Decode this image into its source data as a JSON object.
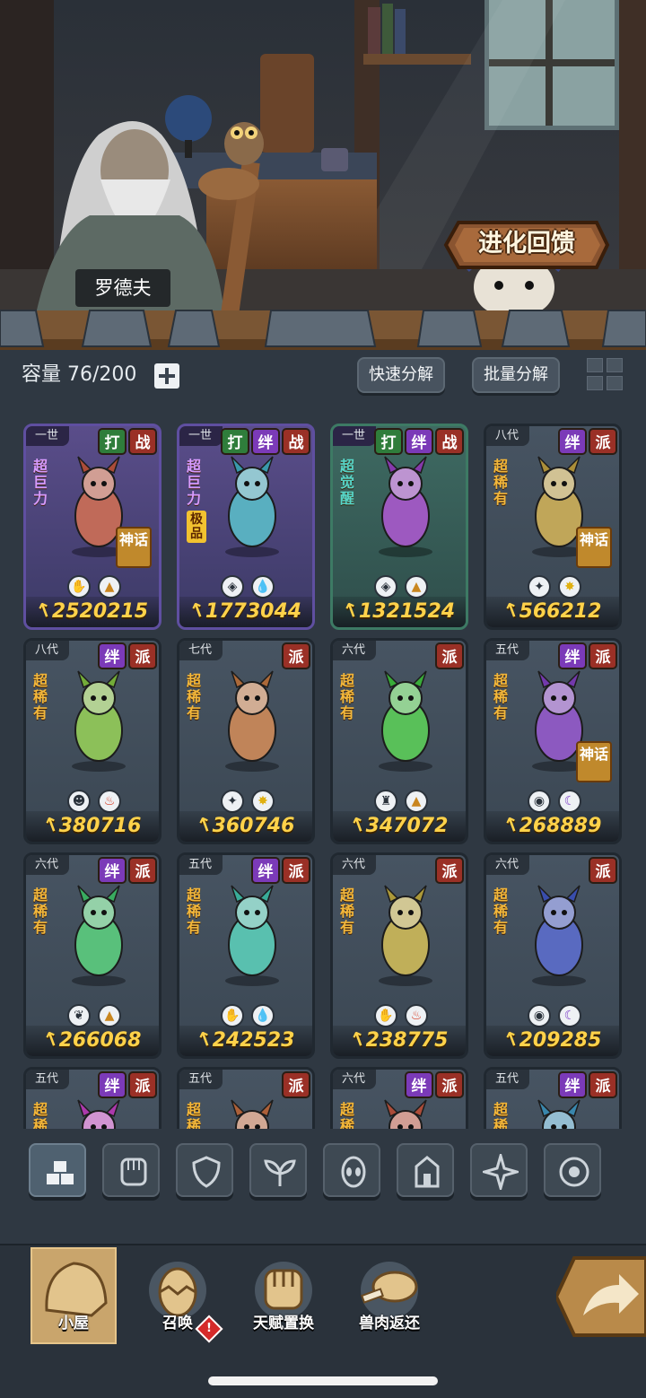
{
  "npc": {
    "name": "罗德夫"
  },
  "evolve_button": {
    "label": "进化回馈"
  },
  "inventory": {
    "capacity_label": "容量 76/200",
    "quick_decompose": "快速分解",
    "batch_decompose": "批量分解"
  },
  "cards": [
    {
      "gen": "一世",
      "badges": [
        "打",
        "战"
      ],
      "rarity": "超巨力",
      "extra": "",
      "myth": "神话",
      "icons": [
        "paw-icon",
        "rock-icon"
      ],
      "power": "2520215",
      "style": "purple"
    },
    {
      "gen": "一世",
      "badges": [
        "打",
        "绊",
        "战"
      ],
      "rarity": "超巨力",
      "extra": "极品",
      "myth": "",
      "icons": [
        "shield-icon",
        "water-icon"
      ],
      "power": "1773044",
      "style": "purple"
    },
    {
      "gen": "一世",
      "badges": [
        "打",
        "绊",
        "战"
      ],
      "rarity": "超觉醒",
      "extra": "",
      "myth": "",
      "icons": [
        "shield-icon",
        "rock-icon"
      ],
      "power": "1321524",
      "style": "green"
    },
    {
      "gen": "八代",
      "badges": [
        "绊",
        "派"
      ],
      "rarity": "超稀有",
      "extra": "",
      "myth": "神话",
      "icons": [
        "star4-icon",
        "sun-icon"
      ],
      "power": "566212",
      "style": "normal"
    },
    {
      "gen": "八代",
      "badges": [
        "绊",
        "派"
      ],
      "rarity": "超稀有",
      "extra": "",
      "myth": "",
      "icons": [
        "alien-icon",
        "fire-icon"
      ],
      "power": "380716",
      "style": "normal"
    },
    {
      "gen": "七代",
      "badges": [
        "派"
      ],
      "rarity": "超稀有",
      "extra": "",
      "myth": "",
      "icons": [
        "star4-icon",
        "sun-icon"
      ],
      "power": "360746",
      "style": "normal"
    },
    {
      "gen": "六代",
      "badges": [
        "派"
      ],
      "rarity": "超稀有",
      "extra": "",
      "myth": "",
      "icons": [
        "tower-icon",
        "rock-icon"
      ],
      "power": "347072",
      "style": "normal"
    },
    {
      "gen": "五代",
      "badges": [
        "绊",
        "派"
      ],
      "rarity": "超稀有",
      "extra": "",
      "myth": "神话",
      "icons": [
        "eye-icon",
        "moon-icon"
      ],
      "power": "268889",
      "style": "normal"
    },
    {
      "gen": "六代",
      "badges": [
        "绊",
        "派"
      ],
      "rarity": "超稀有",
      "extra": "",
      "myth": "",
      "icons": [
        "leaf-icon",
        "rock-icon"
      ],
      "power": "266068",
      "style": "normal"
    },
    {
      "gen": "五代",
      "badges": [
        "绊",
        "派"
      ],
      "rarity": "超稀有",
      "extra": "",
      "myth": "",
      "icons": [
        "paw-icon",
        "water-icon"
      ],
      "power": "242523",
      "style": "normal"
    },
    {
      "gen": "六代",
      "badges": [
        "派"
      ],
      "rarity": "超稀有",
      "extra": "",
      "myth": "",
      "icons": [
        "paw-icon",
        "fire-icon"
      ],
      "power": "238775",
      "style": "normal"
    },
    {
      "gen": "六代",
      "badges": [
        "派"
      ],
      "rarity": "超稀有",
      "extra": "",
      "myth": "",
      "icons": [
        "eye-icon",
        "moon-icon"
      ],
      "power": "209285",
      "style": "normal"
    },
    {
      "gen": "五代",
      "badges": [
        "绊",
        "派"
      ],
      "rarity": "超稀有",
      "extra": "",
      "myth": "",
      "icons": [],
      "power": "",
      "style": "normal"
    },
    {
      "gen": "五代",
      "badges": [
        "派"
      ],
      "rarity": "超稀有",
      "extra": "",
      "myth": "",
      "icons": [],
      "power": "",
      "style": "normal"
    },
    {
      "gen": "六代",
      "badges": [
        "绊",
        "派"
      ],
      "rarity": "超稀有",
      "extra": "",
      "myth": "",
      "icons": [],
      "power": "",
      "style": "normal"
    },
    {
      "gen": "五代",
      "badges": [
        "绊",
        "派"
      ],
      "rarity": "超稀有",
      "extra": "",
      "myth": "",
      "icons": [],
      "power": "",
      "style": "normal"
    }
  ],
  "filters": [
    "all-icon",
    "fist-icon",
    "shield-icon",
    "leaf-icon",
    "alien-icon",
    "tower-icon",
    "star4-icon",
    "eye-icon"
  ],
  "nav": {
    "hut": "小屋",
    "summon": "召唤",
    "talent_swap": "天赋置换",
    "meat_return": "兽肉返还",
    "alert_mark": "!"
  },
  "colors": {
    "power_gold": "#ffd24a",
    "purple_badge": "#7b3ab8",
    "red_badge": "#9a3026",
    "nav_active": "#c9a56c"
  }
}
